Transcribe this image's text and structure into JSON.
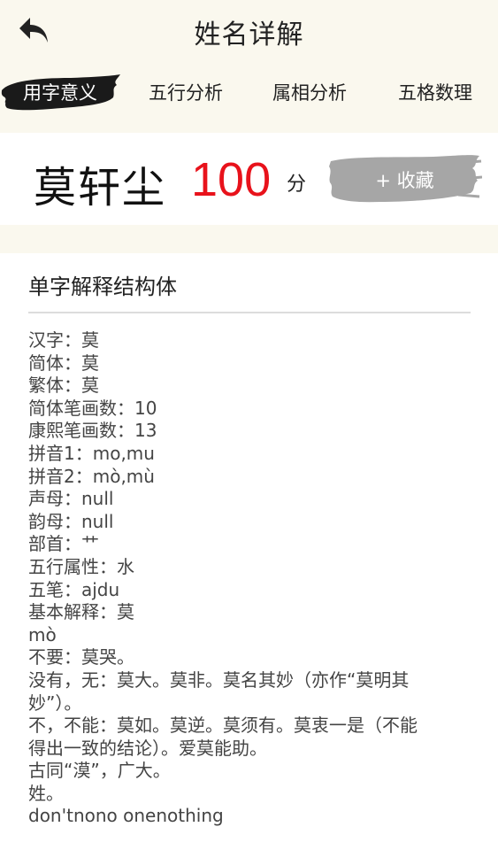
{
  "header": {
    "title": "姓名详解",
    "back_icon": "back-arrow-icon"
  },
  "tabs": [
    {
      "label": "用字意义",
      "active": true
    },
    {
      "label": "五行分析",
      "active": false
    },
    {
      "label": "属相分析",
      "active": false
    },
    {
      "label": "五格数理",
      "active": false
    }
  ],
  "result": {
    "name": "莫轩尘",
    "score": "100",
    "score_unit": "分",
    "favorite_label": "+ 收藏"
  },
  "detail": {
    "section_title": "单字解释结构体",
    "lines": [
      "汉字：莫",
      "简体：莫",
      "繁体：莫",
      "简体笔画数：10",
      "康熙笔画数：13",
      "拼音1：mo,mu",
      "拼音2：mò,mù",
      "声母：null",
      "韵母：null",
      "部首：艹",
      "五行属性：水",
      "五笔：ajdu",
      "基本解释：莫",
      "mò",
      "不要：莫哭。",
      "没有，无：莫大。莫非。莫名其妙（亦作“莫明其",
      "妙”）。",
      "不，不能：莫如。莫逆。莫须有。莫衷一是（不能",
      "得出一致的结论）。爱莫能助。",
      "古同“漠”，广大。",
      "姓。",
      "don'tnono onenothing"
    ]
  },
  "colors": {
    "background": "#faf8ee",
    "score": "#e8121b",
    "tab_brush": "#1a1a1a",
    "favorite_brush": "#a6a6a6"
  }
}
